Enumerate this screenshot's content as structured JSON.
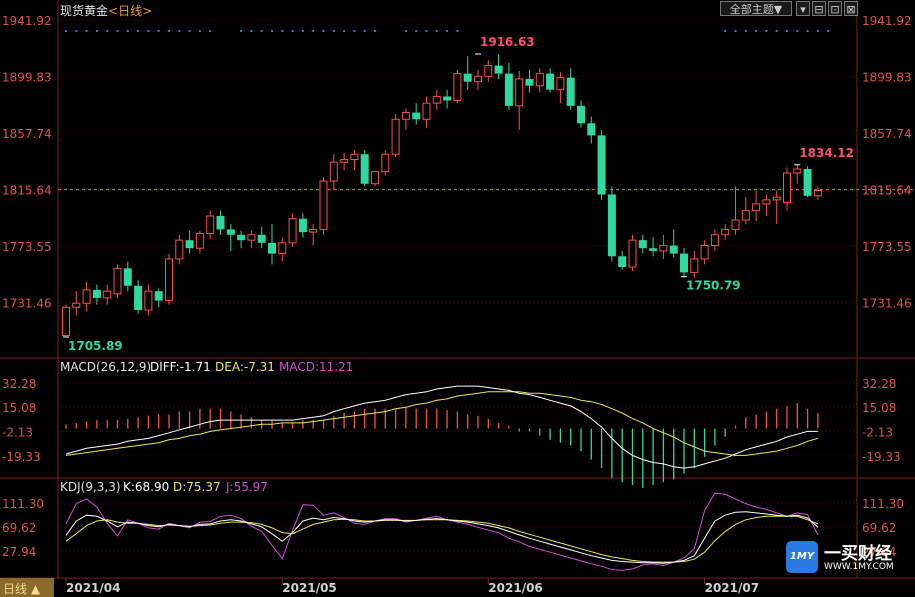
{
  "header": {
    "instrument": "现货黄金",
    "period_link": "<日线>",
    "theme_button": "全部主题▼",
    "window_buttons": [
      "▾",
      "⊟",
      "⊡",
      "⊠"
    ]
  },
  "bottom_bar": {
    "period_button": "日线 ▲"
  },
  "logo": {
    "badge": "1MY",
    "name": "一买财经",
    "url": "WWW.1MY.COM"
  },
  "colors": {
    "up": "#ff4d4d",
    "down": "#2ed8a0",
    "price_axis": "#e05050",
    "dif": "#ffffff",
    "dea": "#e8e85a",
    "macd_label": "#d24dd2",
    "grid": "#3a1a1a",
    "dots": "#2a7fd4"
  },
  "chart_data": [
    {
      "type": "candlestick",
      "title": "现货黄金<日线>",
      "ylim": [
        1705.89,
        1941.92
      ],
      "y_ticks": [
        "1941.92",
        "1899.83",
        "1857.74",
        "1815.64",
        "1773.55",
        "1731.46"
      ],
      "current_price_line": "1815.64",
      "x_tick_labels": [
        {
          "label": "2021/04",
          "index": 0
        },
        {
          "label": "2021/05",
          "index": 21
        },
        {
          "label": "2021/06",
          "index": 41
        },
        {
          "label": "2021/07",
          "index": 62
        }
      ],
      "annotations": [
        {
          "label": "1916.63",
          "index": 40,
          "value": 1916.63,
          "color": "#ff4d73"
        },
        {
          "label": "1705.89",
          "index": 0,
          "value": 1705.89,
          "color": "#2ed8a0"
        },
        {
          "label": "1750.79",
          "index": 60,
          "value": 1750.79,
          "color": "#2ed8a0"
        },
        {
          "label": "1834.12",
          "index": 71,
          "value": 1834.12,
          "color": "#ff4d73"
        }
      ],
      "candles": [
        {
          "o": 1707,
          "h": 1730,
          "l": 1705.9,
          "c": 1728
        },
        {
          "o": 1728,
          "h": 1740,
          "l": 1722,
          "c": 1731
        },
        {
          "o": 1731,
          "h": 1747,
          "l": 1725,
          "c": 1741
        },
        {
          "o": 1741,
          "h": 1745,
          "l": 1730,
          "c": 1735
        },
        {
          "o": 1735,
          "h": 1745,
          "l": 1730,
          "c": 1740
        },
        {
          "o": 1738,
          "h": 1760,
          "l": 1735,
          "c": 1757
        },
        {
          "o": 1757,
          "h": 1762,
          "l": 1740,
          "c": 1744
        },
        {
          "o": 1744,
          "h": 1748,
          "l": 1723,
          "c": 1726
        },
        {
          "o": 1726,
          "h": 1745,
          "l": 1722,
          "c": 1740
        },
        {
          "o": 1740,
          "h": 1742,
          "l": 1728,
          "c": 1733
        },
        {
          "o": 1733,
          "h": 1768,
          "l": 1730,
          "c": 1764
        },
        {
          "o": 1764,
          "h": 1782,
          "l": 1760,
          "c": 1778
        },
        {
          "o": 1778,
          "h": 1785,
          "l": 1768,
          "c": 1772
        },
        {
          "o": 1772,
          "h": 1785,
          "l": 1768,
          "c": 1783
        },
        {
          "o": 1783,
          "h": 1800,
          "l": 1779,
          "c": 1796
        },
        {
          "o": 1796,
          "h": 1800,
          "l": 1782,
          "c": 1786
        },
        {
          "o": 1786,
          "h": 1790,
          "l": 1770,
          "c": 1782
        },
        {
          "o": 1782,
          "h": 1785,
          "l": 1772,
          "c": 1778
        },
        {
          "o": 1778,
          "h": 1785,
          "l": 1772,
          "c": 1782
        },
        {
          "o": 1782,
          "h": 1788,
          "l": 1772,
          "c": 1776
        },
        {
          "o": 1776,
          "h": 1790,
          "l": 1760,
          "c": 1768
        },
        {
          "o": 1768,
          "h": 1780,
          "l": 1762,
          "c": 1776
        },
        {
          "o": 1776,
          "h": 1798,
          "l": 1773,
          "c": 1794
        },
        {
          "o": 1794,
          "h": 1798,
          "l": 1780,
          "c": 1784
        },
        {
          "o": 1784,
          "h": 1790,
          "l": 1774,
          "c": 1786
        },
        {
          "o": 1786,
          "h": 1825,
          "l": 1782,
          "c": 1822
        },
        {
          "o": 1822,
          "h": 1842,
          "l": 1815,
          "c": 1836
        },
        {
          "o": 1836,
          "h": 1843,
          "l": 1830,
          "c": 1838
        },
        {
          "o": 1838,
          "h": 1845,
          "l": 1830,
          "c": 1842
        },
        {
          "o": 1842,
          "h": 1845,
          "l": 1818,
          "c": 1820
        },
        {
          "o": 1820,
          "h": 1830,
          "l": 1818,
          "c": 1829
        },
        {
          "o": 1829,
          "h": 1845,
          "l": 1826,
          "c": 1842
        },
        {
          "o": 1842,
          "h": 1872,
          "l": 1840,
          "c": 1868
        },
        {
          "o": 1868,
          "h": 1876,
          "l": 1860,
          "c": 1873
        },
        {
          "o": 1873,
          "h": 1880,
          "l": 1864,
          "c": 1868
        },
        {
          "o": 1868,
          "h": 1885,
          "l": 1862,
          "c": 1880
        },
        {
          "o": 1880,
          "h": 1890,
          "l": 1875,
          "c": 1885
        },
        {
          "o": 1885,
          "h": 1890,
          "l": 1876,
          "c": 1882
        },
        {
          "o": 1882,
          "h": 1905,
          "l": 1880,
          "c": 1902
        },
        {
          "o": 1902,
          "h": 1915,
          "l": 1890,
          "c": 1896
        },
        {
          "o": 1896,
          "h": 1905,
          "l": 1890,
          "c": 1900
        },
        {
          "o": 1900,
          "h": 1912,
          "l": 1896,
          "c": 1908
        },
        {
          "o": 1908,
          "h": 1916.6,
          "l": 1898,
          "c": 1902
        },
        {
          "o": 1902,
          "h": 1910,
          "l": 1875,
          "c": 1878
        },
        {
          "o": 1878,
          "h": 1904,
          "l": 1860,
          "c": 1898
        },
        {
          "o": 1898,
          "h": 1905,
          "l": 1888,
          "c": 1893
        },
        {
          "o": 1893,
          "h": 1906,
          "l": 1888,
          "c": 1902
        },
        {
          "o": 1902,
          "h": 1906,
          "l": 1888,
          "c": 1890
        },
        {
          "o": 1890,
          "h": 1903,
          "l": 1880,
          "c": 1899
        },
        {
          "o": 1899,
          "h": 1906,
          "l": 1875,
          "c": 1878
        },
        {
          "o": 1878,
          "h": 1882,
          "l": 1862,
          "c": 1865
        },
        {
          "o": 1865,
          "h": 1870,
          "l": 1850,
          "c": 1856
        },
        {
          "o": 1856,
          "h": 1860,
          "l": 1808,
          "c": 1812
        },
        {
          "o": 1812,
          "h": 1818,
          "l": 1762,
          "c": 1766
        },
        {
          "o": 1766,
          "h": 1770,
          "l": 1756,
          "c": 1758
        },
        {
          "o": 1758,
          "h": 1782,
          "l": 1755,
          "c": 1778
        },
        {
          "o": 1778,
          "h": 1782,
          "l": 1768,
          "c": 1772
        },
        {
          "o": 1772,
          "h": 1780,
          "l": 1766,
          "c": 1770
        },
        {
          "o": 1770,
          "h": 1782,
          "l": 1764,
          "c": 1774
        },
        {
          "o": 1774,
          "h": 1786,
          "l": 1765,
          "c": 1768
        },
        {
          "o": 1768,
          "h": 1772,
          "l": 1750.8,
          "c": 1754
        },
        {
          "o": 1754,
          "h": 1770,
          "l": 1750,
          "c": 1764
        },
        {
          "o": 1764,
          "h": 1778,
          "l": 1760,
          "c": 1774
        },
        {
          "o": 1774,
          "h": 1786,
          "l": 1770,
          "c": 1782
        },
        {
          "o": 1782,
          "h": 1790,
          "l": 1778,
          "c": 1786
        },
        {
          "o": 1786,
          "h": 1818,
          "l": 1782,
          "c": 1793
        },
        {
          "o": 1793,
          "h": 1810,
          "l": 1790,
          "c": 1800
        },
        {
          "o": 1800,
          "h": 1815,
          "l": 1792,
          "c": 1805
        },
        {
          "o": 1805,
          "h": 1812,
          "l": 1796,
          "c": 1808
        },
        {
          "o": 1808,
          "h": 1815,
          "l": 1790,
          "c": 1810
        },
        {
          "o": 1806,
          "h": 1832,
          "l": 1800,
          "c": 1828
        },
        {
          "o": 1828,
          "h": 1834.1,
          "l": 1820,
          "c": 1831
        },
        {
          "o": 1831,
          "h": 1833,
          "l": 1810,
          "c": 1811
        },
        {
          "o": 1811,
          "h": 1818,
          "l": 1808,
          "c": 1815
        }
      ]
    },
    {
      "type": "line",
      "title": "MACD(26,12,9)",
      "ylim": [
        -35,
        40
      ],
      "y_ticks": [
        "32.28",
        "15.08",
        "-2.13",
        "-19.33"
      ],
      "legend": [
        {
          "label": "DIFF:-1.71",
          "color": "#ffffff"
        },
        {
          "label": "DEA:-7.31",
          "color": "#e8e85a"
        },
        {
          "label": "MACD:11.21",
          "color": "#d24dd2"
        }
      ],
      "series": [
        {
          "name": "DIFF",
          "values": [
            -18,
            -16,
            -14,
            -13,
            -12,
            -11,
            -9,
            -8,
            -7,
            -5,
            -3,
            -1,
            1,
            3,
            5,
            6,
            6,
            6,
            6,
            6,
            6,
            6,
            6,
            7,
            8,
            9,
            12,
            14,
            16,
            18,
            19,
            20,
            22,
            24,
            25,
            26,
            28,
            29,
            30,
            30,
            30,
            29,
            28,
            27,
            25,
            24,
            22,
            20,
            18,
            16,
            12,
            7,
            1,
            -7,
            -14,
            -19,
            -22,
            -24,
            -25,
            -27,
            -28,
            -27,
            -25,
            -23,
            -21,
            -18,
            -15,
            -13,
            -11,
            -9,
            -6,
            -4,
            -2,
            -2
          ]
        },
        {
          "name": "DEA",
          "values": [
            -19,
            -18,
            -17,
            -16,
            -15,
            -14,
            -13,
            -12,
            -11,
            -10,
            -8,
            -7,
            -5,
            -4,
            -2,
            -1,
            0,
            1,
            2,
            3,
            3,
            4,
            4,
            4,
            5,
            6,
            7,
            8,
            9,
            10,
            11,
            12,
            14,
            15,
            17,
            18,
            20,
            21,
            23,
            24,
            25,
            26,
            26,
            26,
            26,
            25,
            25,
            24,
            23,
            22,
            20,
            19,
            17,
            14,
            11,
            7,
            4,
            0,
            -3,
            -6,
            -10,
            -13,
            -16,
            -17,
            -18,
            -19,
            -19,
            -18,
            -17,
            -16,
            -14,
            -12,
            -9,
            -7
          ]
        },
        {
          "name": "MACD",
          "values": [
            3,
            4,
            5,
            6,
            6,
            6,
            7,
            8,
            9,
            10,
            10,
            12,
            12,
            14,
            14,
            14,
            12,
            10,
            8,
            6,
            6,
            4,
            4,
            6,
            6,
            6,
            9,
            11,
            12,
            14,
            14,
            14,
            14,
            15,
            14,
            14,
            14,
            13,
            12,
            10,
            9,
            7,
            4,
            2,
            -2,
            -2,
            -5,
            -8,
            -10,
            -12,
            -16,
            -22,
            -28,
            -35,
            -38,
            -40,
            -42,
            -40,
            -38,
            -36,
            -32,
            -28,
            -20,
            -12,
            -6,
            2,
            8,
            10,
            12,
            14,
            16,
            18,
            14,
            11
          ]
        }
      ]
    },
    {
      "type": "line",
      "title": "KDJ(9,3,3)",
      "ylim": [
        -15,
        130
      ],
      "y_ticks": [
        "111.30",
        "69.62",
        "27.94"
      ],
      "legend": [
        {
          "label": "K:68.90",
          "color": "#ffffff"
        },
        {
          "label": "D:75.37",
          "color": "#e8e85a"
        },
        {
          "label": "J:55.97",
          "color": "#d24dd2"
        }
      ],
      "series": [
        {
          "name": "K",
          "values": [
            55,
            80,
            90,
            88,
            80,
            70,
            78,
            76,
            72,
            70,
            74,
            72,
            70,
            74,
            75,
            80,
            82,
            80,
            75,
            70,
            58,
            45,
            60,
            80,
            85,
            82,
            86,
            84,
            80,
            78,
            80,
            82,
            82,
            80,
            81,
            83,
            84,
            82,
            80,
            78,
            75,
            72,
            68,
            62,
            56,
            50,
            45,
            40,
            35,
            30,
            25,
            20,
            16,
            12,
            10,
            9,
            8,
            8,
            7,
            9,
            12,
            20,
            50,
            80,
            90,
            95,
            96,
            94,
            92,
            90,
            88,
            90,
            85,
            69
          ]
        },
        {
          "name": "D",
          "values": [
            45,
            58,
            72,
            80,
            82,
            78,
            76,
            76,
            74,
            72,
            73,
            72,
            71,
            72,
            73,
            76,
            78,
            78,
            77,
            74,
            68,
            60,
            58,
            66,
            74,
            78,
            82,
            83,
            82,
            80,
            80,
            81,
            81,
            81,
            81,
            82,
            82,
            82,
            81,
            80,
            78,
            76,
            72,
            68,
            62,
            57,
            52,
            47,
            42,
            37,
            32,
            27,
            22,
            18,
            15,
            12,
            10,
            9,
            9,
            9,
            10,
            14,
            26,
            46,
            62,
            74,
            82,
            86,
            88,
            88,
            88,
            88,
            82,
            75
          ]
        },
        {
          "name": "J",
          "values": [
            75,
            110,
            118,
            104,
            76,
            54,
            82,
            76,
            68,
            66,
            76,
            72,
            68,
            78,
            79,
            88,
            90,
            84,
            71,
            62,
            38,
            15,
            64,
            108,
            107,
            90,
            94,
            86,
            76,
            74,
            80,
            84,
            84,
            78,
            81,
            85,
            88,
            82,
            78,
            74,
            69,
            64,
            60,
            50,
            44,
            36,
            31,
            26,
            21,
            16,
            11,
            6,
            2,
            -4,
            -5,
            -3,
            4,
            6,
            3,
            9,
            16,
            32,
            98,
            128,
            126,
            118,
            110,
            104,
            100,
            94,
            88,
            94,
            91,
            56
          ]
        }
      ]
    }
  ]
}
